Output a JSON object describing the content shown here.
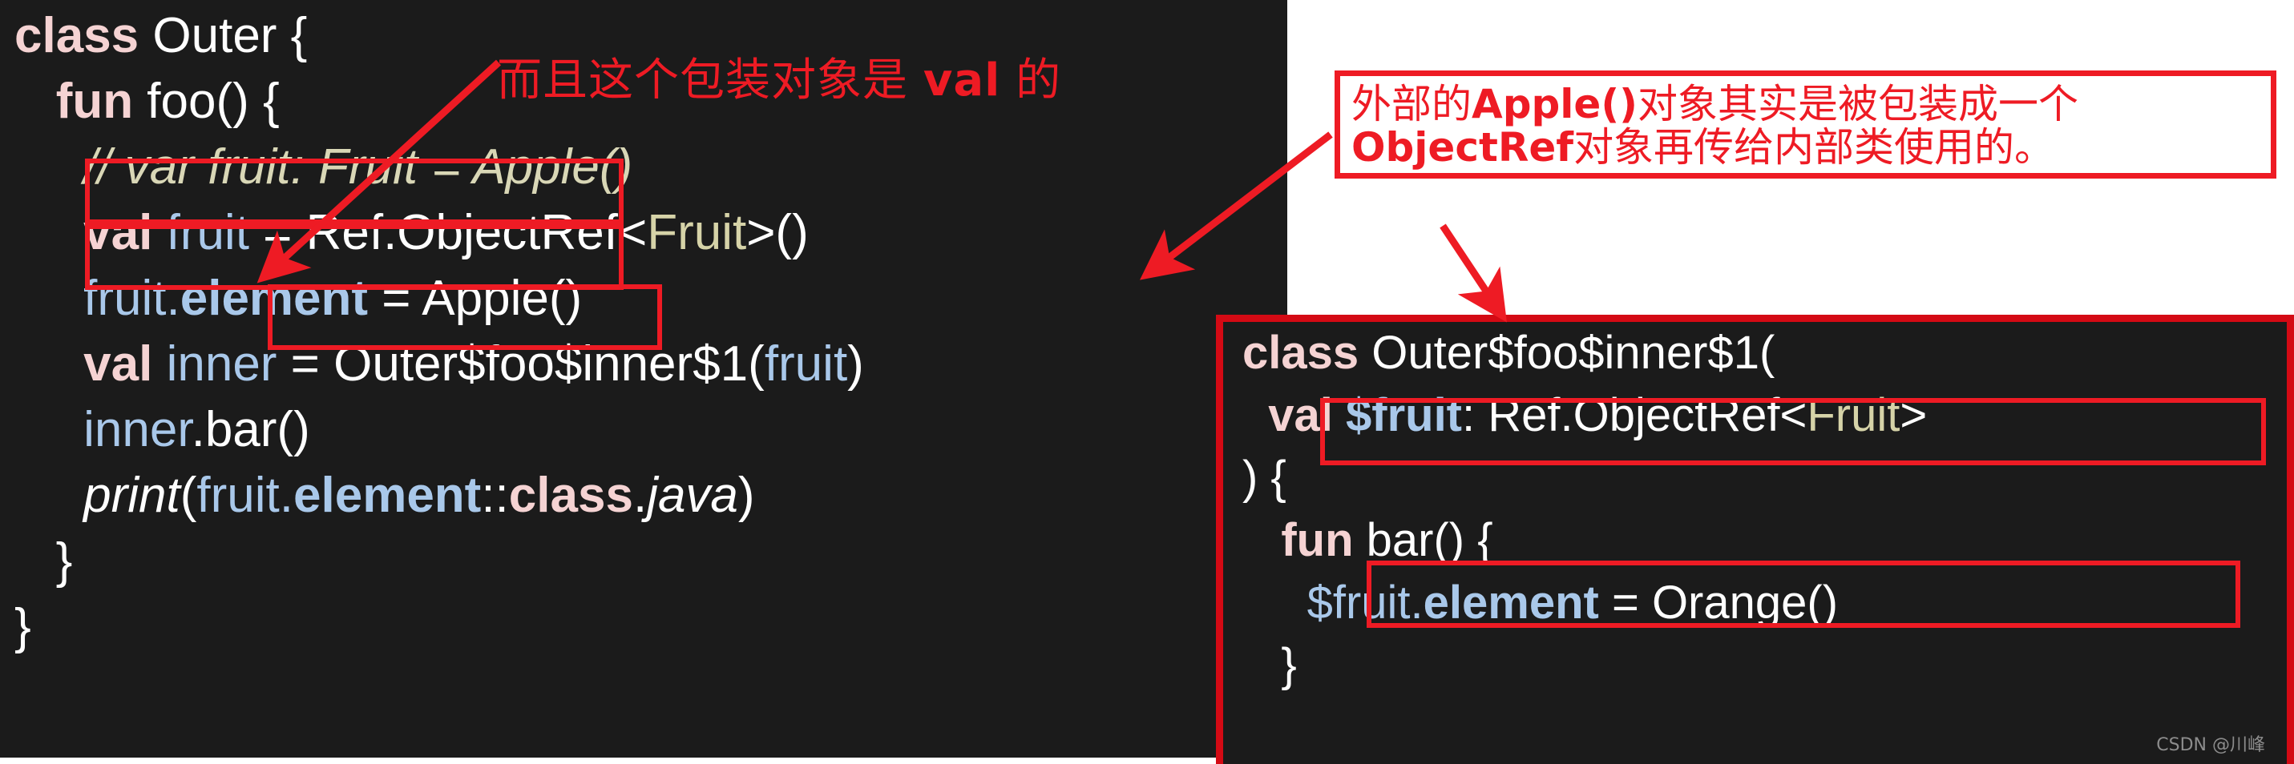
{
  "left_code": {
    "lines": [
      {
        "id": "l1",
        "tokens": [
          {
            "t": "class",
            "c": "kw"
          },
          {
            "t": " Outer {",
            "c": "plain"
          }
        ]
      },
      {
        "id": "l2",
        "tokens": [
          {
            "t": "   ",
            "c": "plain"
          },
          {
            "t": "fun",
            "c": "kw"
          },
          {
            "t": " foo() {",
            "c": "plain"
          }
        ]
      },
      {
        "id": "l3",
        "tokens": [
          {
            "t": "     // var fruit: Fruit = Apple()",
            "c": "cmt"
          }
        ]
      },
      {
        "id": "l4",
        "tokens": [
          {
            "t": "     ",
            "c": "plain"
          },
          {
            "t": "val",
            "c": "kw"
          },
          {
            "t": " ",
            "c": "plain"
          },
          {
            "t": "fruit",
            "c": "prop"
          },
          {
            "t": " = Ref.ObjectRef",
            "c": "plain"
          },
          {
            "t": "<",
            "c": "plain"
          },
          {
            "t": "Fruit",
            "c": "type"
          },
          {
            "t": ">",
            "c": "plain"
          },
          {
            "t": "()",
            "c": "plain"
          }
        ]
      },
      {
        "id": "l5",
        "tokens": [
          {
            "t": "     ",
            "c": "plain"
          },
          {
            "t": "fruit.",
            "c": "prop"
          },
          {
            "t": "element",
            "c": "propb"
          },
          {
            "t": " = Apple()",
            "c": "plain"
          }
        ]
      },
      {
        "id": "l6",
        "tokens": [
          {
            "t": "     ",
            "c": "plain"
          },
          {
            "t": "val",
            "c": "kw"
          },
          {
            "t": " ",
            "c": "plain"
          },
          {
            "t": "inner",
            "c": "prop"
          },
          {
            "t": " = Outer$foo$inner$1(",
            "c": "plain"
          },
          {
            "t": "fruit",
            "c": "prop"
          },
          {
            "t": ")",
            "c": "plain"
          }
        ]
      },
      {
        "id": "l7",
        "tokens": [
          {
            "t": "     ",
            "c": "plain"
          },
          {
            "t": "inner",
            "c": "prop"
          },
          {
            "t": ".bar()",
            "c": "plain"
          }
        ]
      },
      {
        "id": "l8",
        "tokens": [
          {
            "t": "     ",
            "c": "plain"
          },
          {
            "t": "print",
            "c": "ital"
          },
          {
            "t": "(",
            "c": "plain"
          },
          {
            "t": "fruit.",
            "c": "prop"
          },
          {
            "t": "element",
            "c": "propb"
          },
          {
            "t": "::",
            "c": "plain"
          },
          {
            "t": "class",
            "c": "kw"
          },
          {
            "t": ".",
            "c": "plain"
          },
          {
            "t": "java",
            "c": "ital"
          },
          {
            "t": ")",
            "c": "plain"
          }
        ]
      },
      {
        "id": "l9",
        "tokens": [
          {
            "t": "   }",
            "c": "plain"
          }
        ]
      },
      {
        "id": "l10",
        "tokens": [
          {
            "t": "}",
            "c": "plain"
          }
        ]
      }
    ]
  },
  "right_code": {
    "lines": [
      {
        "id": "r1",
        "tokens": [
          {
            "t": "class",
            "c": "kw"
          },
          {
            "t": " Outer$foo$inner$1(",
            "c": "plain"
          }
        ]
      },
      {
        "id": "r2",
        "tokens": [
          {
            "t": "  ",
            "c": "plain"
          },
          {
            "t": "val",
            "c": "kw"
          },
          {
            "t": " ",
            "c": "plain"
          },
          {
            "t": "$fruit",
            "c": "propb"
          },
          {
            "t": ": Ref.ObjectRef",
            "c": "plain"
          },
          {
            "t": "<",
            "c": "plain"
          },
          {
            "t": "Fruit",
            "c": "type"
          },
          {
            "t": ">",
            "c": "plain"
          }
        ]
      },
      {
        "id": "r3",
        "tokens": [
          {
            "t": ") {",
            "c": "plain"
          }
        ]
      },
      {
        "id": "r4",
        "tokens": [
          {
            "t": "   ",
            "c": "plain"
          },
          {
            "t": "fun",
            "c": "kw"
          },
          {
            "t": " bar() {",
            "c": "plain"
          }
        ]
      },
      {
        "id": "r5",
        "tokens": [
          {
            "t": "     ",
            "c": "plain"
          },
          {
            "t": "$fruit.",
            "c": "prop"
          },
          {
            "t": "element",
            "c": "propb"
          },
          {
            "t": " = Orange()",
            "c": "plain"
          }
        ]
      },
      {
        "id": "r6",
        "tokens": [
          {
            "t": "   }",
            "c": "plain"
          }
        ]
      }
    ]
  },
  "annotations": {
    "top_note": {
      "parts": [
        {
          "t": "而且这个包装对象是 ",
          "b": false
        },
        {
          "t": "val",
          "b": true
        },
        {
          "t": " 的",
          "b": false
        }
      ]
    },
    "box_note": {
      "line1": [
        {
          "t": "外部的",
          "b": false
        },
        {
          "t": "Apple()",
          "b": true
        },
        {
          "t": "对象其实是被包装成一个",
          "b": false
        }
      ],
      "line2": [
        {
          "t": "ObjectRef",
          "b": true
        },
        {
          "t": "对象再传给内部类使用的。",
          "b": false
        }
      ]
    }
  },
  "highlights": [
    {
      "name": "highlight-val-fruit"
    },
    {
      "name": "highlight-fruit-element"
    },
    {
      "name": "highlight-inner-constructor"
    },
    {
      "name": "highlight-val-dollar-fruit"
    },
    {
      "name": "highlight-dollar-fruit-element"
    }
  ],
  "colors": {
    "accent_red": "#ee1b24",
    "panel_bg": "#1b1b1b",
    "keyword": "#f5d3d3",
    "property": "#a9c8ea",
    "type": "#d6d3a8",
    "comment": "#d9d7b6",
    "page_bg": "#ffffff"
  },
  "watermark": {
    "text": "CSDN @川峰"
  }
}
